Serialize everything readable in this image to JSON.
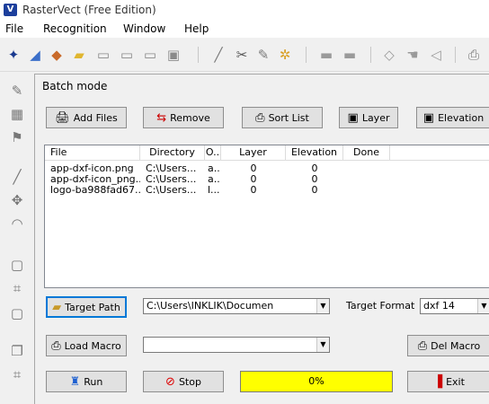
{
  "app": {
    "title": "RasterVect (Free Edition)",
    "icon": "rastervect-logo-icon"
  },
  "menu": [
    "File",
    "Recognition",
    "Window",
    "Help"
  ],
  "toolbar_icons": [
    "magic-wand-icon",
    "eraser-icon",
    "fill-icon",
    "open-folder-icon",
    "image-icon",
    "image-icon",
    "image-icon",
    "scanner-icon",
    "pen-icon",
    "scissors-icon",
    "edit-icon",
    "settings-gear-icon",
    "copy-icon",
    "paste-icon",
    "select-icon",
    "hand-icon",
    "cursor-icon",
    "print-icon"
  ],
  "dialog": {
    "title": "Batch mode",
    "buttons": {
      "add_files": "Add Files",
      "remove": "Remove",
      "sort_list": "Sort List",
      "layer": "Layer",
      "elevation": "Elevation",
      "target_path": "Target Path",
      "load_macro": "Load Macro",
      "del_macro": "Del Macro",
      "run": "Run",
      "stop": "Stop",
      "exit": "Exit"
    },
    "list": {
      "columns": [
        "File",
        "Directory",
        "O..",
        "Layer",
        "Elevation",
        "Done"
      ],
      "rows": [
        [
          "app-dxf-icon.png",
          "C:\\Users...",
          "a...",
          "0",
          "0",
          ""
        ],
        [
          "app-dxf-icon_png....",
          "C:\\Users...",
          "a...",
          "0",
          "0",
          ""
        ],
        [
          "logo-ba988fad67....",
          "C:\\Users...",
          "l...",
          "0",
          "0",
          ""
        ]
      ]
    },
    "target_path_value": "C:\\Users\\INKLIK\\Documen",
    "target_format_label": "Target Format",
    "target_format_value": "dxf 14",
    "macro_value": "",
    "progress": {
      "text": "0%",
      "fraction": 0.0
    }
  }
}
